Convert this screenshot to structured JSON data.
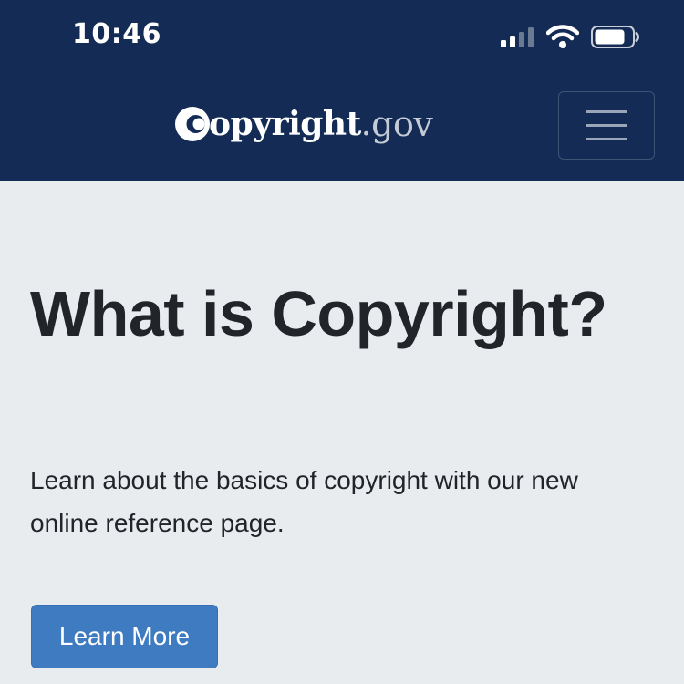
{
  "status_bar": {
    "time": "10:46",
    "icons": [
      "cellular-signal-icon",
      "wifi-icon",
      "battery-icon"
    ]
  },
  "navbar": {
    "logo": {
      "main": "opyright",
      "dot": ".",
      "suffix": "gov",
      "full_text": "Copyright.gov"
    },
    "menu_icon": "hamburger-menu-icon"
  },
  "hero": {
    "title": "What is Copyright?",
    "lead": "Learn about the basics of copyright with our new online reference page.",
    "button_label": "Learn More"
  },
  "colors": {
    "header_bg": "#142c55",
    "hero_bg": "#e9ecef",
    "text": "#212529",
    "button_bg": "#3e7bc1"
  }
}
